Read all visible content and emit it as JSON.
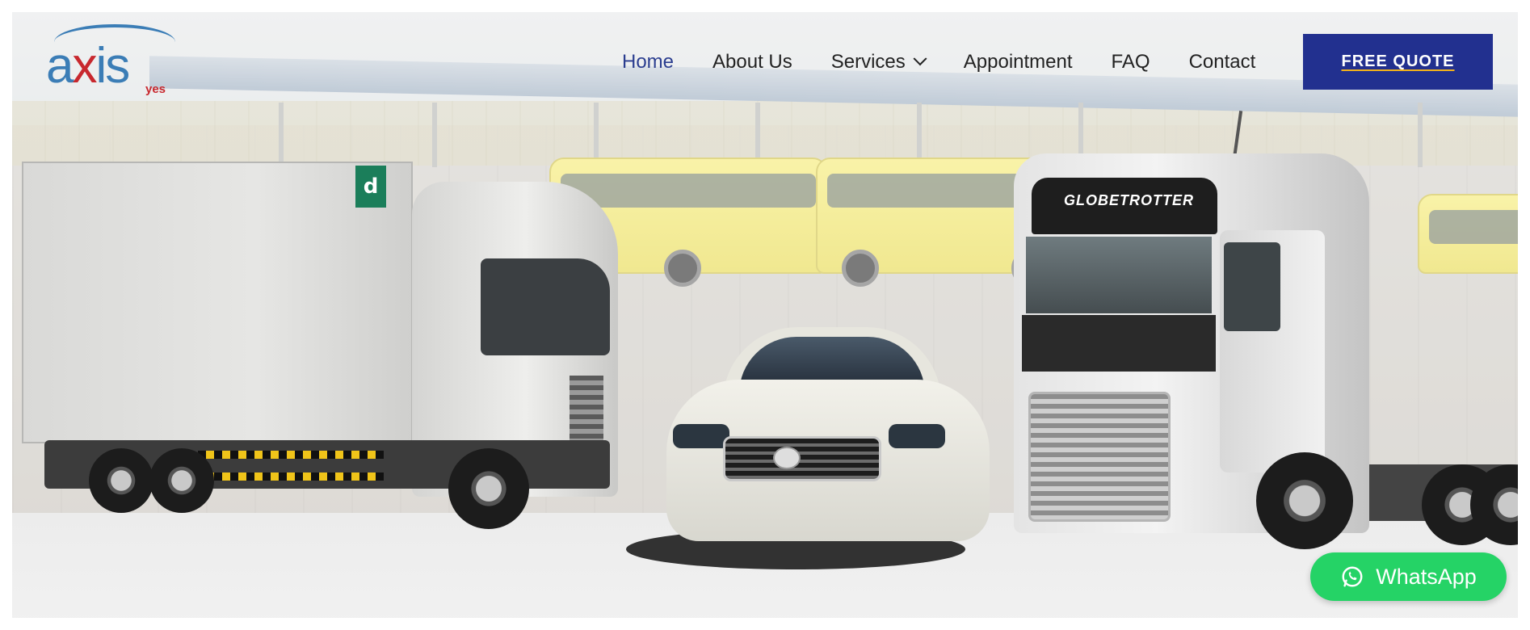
{
  "brand": {
    "logo_text_a": "a",
    "logo_text_x": "x",
    "logo_text_is": "is",
    "logo_sub": "yes"
  },
  "nav": {
    "items": [
      {
        "label": "Home",
        "active": true
      },
      {
        "label": "About Us",
        "active": false
      },
      {
        "label": "Services",
        "active": false,
        "has_dropdown": true
      },
      {
        "label": "Appointment",
        "active": false
      },
      {
        "label": "FAQ",
        "active": false
      },
      {
        "label": "Contact",
        "active": false
      }
    ]
  },
  "cta": {
    "quote_label": "FREE QUOTE"
  },
  "whatsapp": {
    "label": "WhatsApp",
    "icon": "whatsapp-icon"
  },
  "hero": {
    "truck_badge": "d",
    "cab_lettering": "GLOBETROTTER"
  },
  "colors": {
    "nav_active": "#2a3d8f",
    "quote_bg": "#22308f",
    "quote_underline": "#f3b21b",
    "whatsapp_bg": "#25d366",
    "logo_blue": "#3b7db6",
    "logo_red": "#c8282e"
  }
}
